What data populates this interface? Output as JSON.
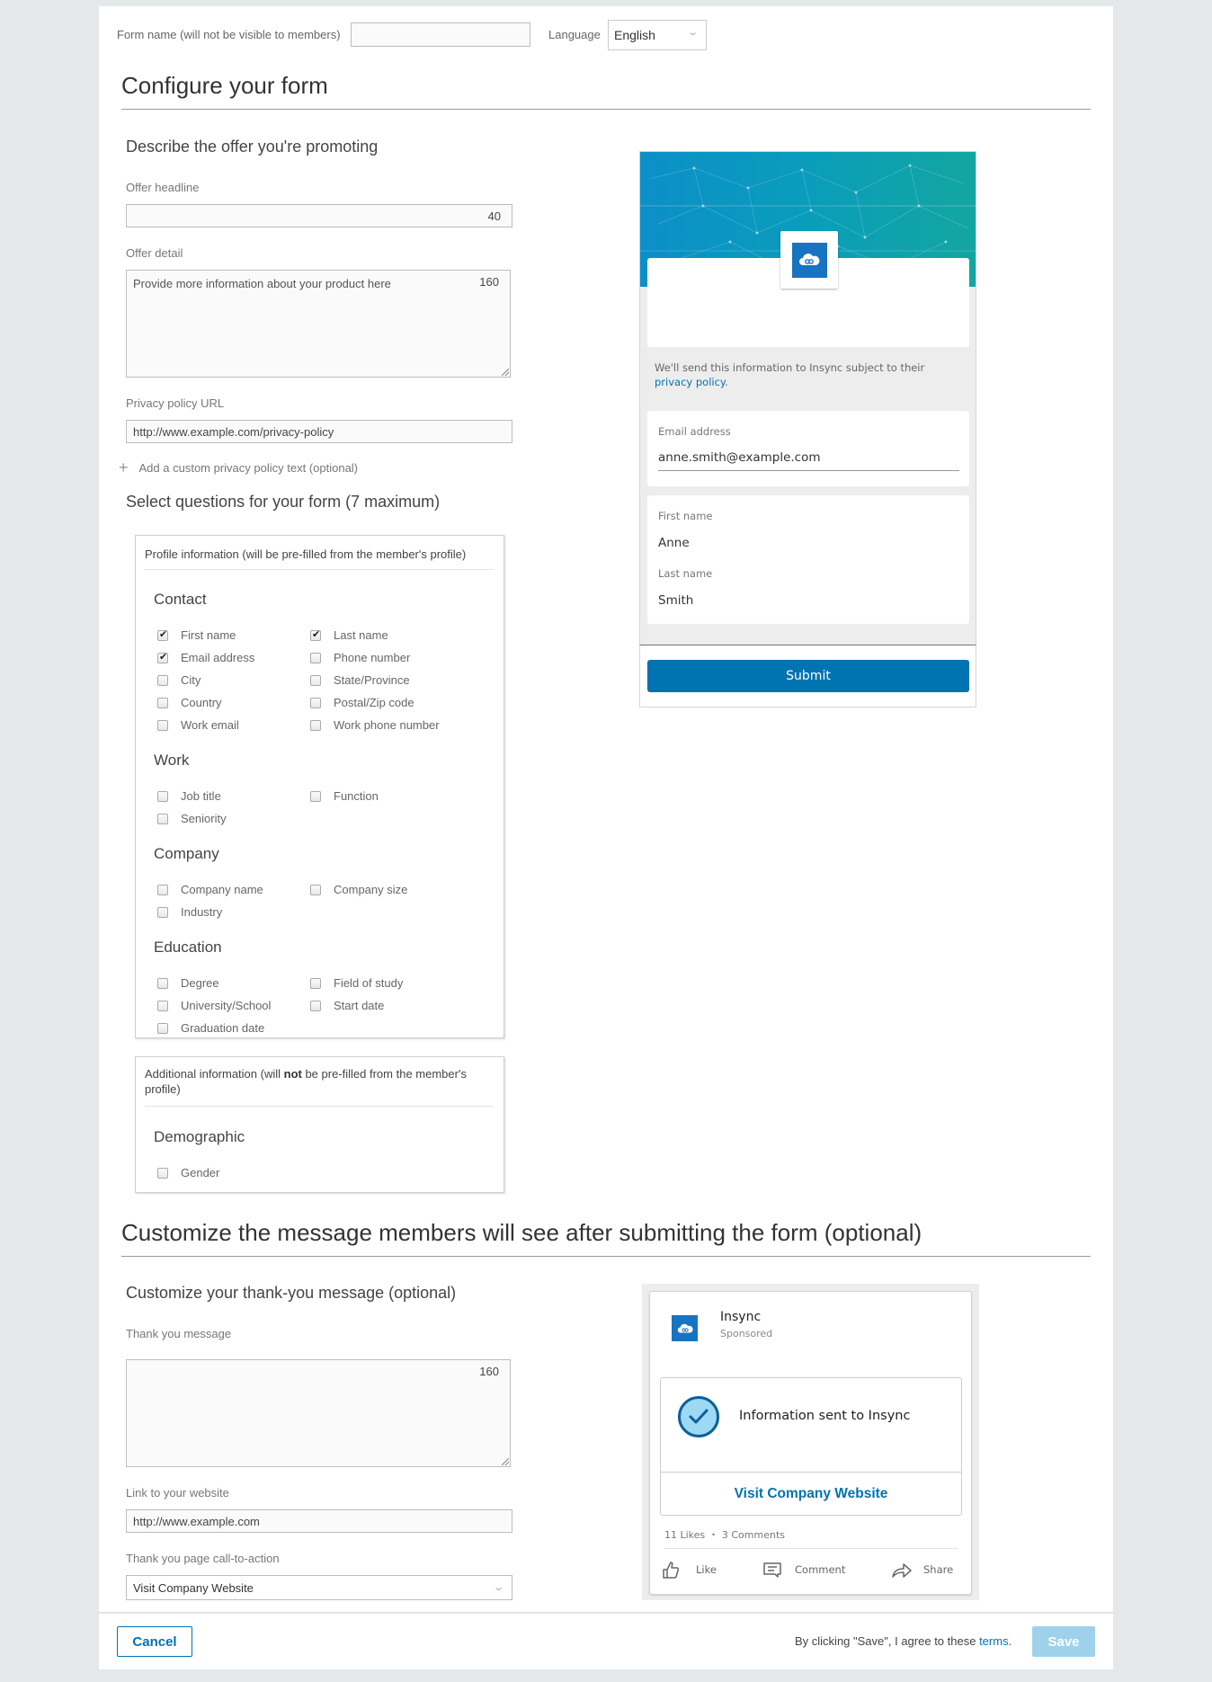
{
  "top_bar": {
    "form_name_label": "Form name (will not be visible to members)",
    "form_name_value": "",
    "language_label": "Language",
    "language_value": "English"
  },
  "configure": {
    "title": "Configure your form",
    "offer_section_title": "Describe the offer you're promoting",
    "offer_headline_label": "Offer headline",
    "offer_headline_value": "",
    "offer_headline_counter": "40",
    "offer_detail_label": "Offer detail",
    "offer_detail_placeholder": "Provide more information about your product here",
    "offer_detail_counter": "160",
    "privacy_url_label": "Privacy policy URL",
    "privacy_url_value": "http://www.example.com/privacy-policy",
    "custom_privacy_link": "Add a custom privacy policy text (optional)",
    "questions_title": "Select questions for your form (7 maximum)"
  },
  "profile_box": {
    "title": "Profile information (will be pre-filled from the member's profile)",
    "categories": [
      {
        "name": "Contact",
        "items": [
          {
            "label": "First name",
            "checked": true
          },
          {
            "label": "Last name",
            "checked": true
          },
          {
            "label": "Email address",
            "checked": true
          },
          {
            "label": "Phone number",
            "checked": false
          },
          {
            "label": "City",
            "checked": false
          },
          {
            "label": "State/Province",
            "checked": false
          },
          {
            "label": "Country",
            "checked": false
          },
          {
            "label": "Postal/Zip code",
            "checked": false
          },
          {
            "label": "Work email",
            "checked": false
          },
          {
            "label": "Work phone number",
            "checked": false
          }
        ]
      },
      {
        "name": "Work",
        "items": [
          {
            "label": "Job title",
            "checked": false
          },
          {
            "label": "Function",
            "checked": false
          },
          {
            "label": "Seniority",
            "checked": false
          }
        ]
      },
      {
        "name": "Company",
        "items": [
          {
            "label": "Company name",
            "checked": false
          },
          {
            "label": "Company size",
            "checked": false
          },
          {
            "label": "Industry",
            "checked": false
          }
        ]
      },
      {
        "name": "Education",
        "items": [
          {
            "label": "Degree",
            "checked": false
          },
          {
            "label": "Field of study",
            "checked": false
          },
          {
            "label": "University/School",
            "checked": false
          },
          {
            "label": "Start date",
            "checked": false
          },
          {
            "label": "Graduation date",
            "checked": false
          }
        ]
      }
    ]
  },
  "additional_box": {
    "title_pre": "Additional information (will ",
    "title_bold": "not",
    "title_post": " be pre-filled from the member's profile)",
    "categories": [
      {
        "name": "Demographic",
        "items": [
          {
            "label": "Gender",
            "checked": false
          }
        ]
      }
    ]
  },
  "form_preview": {
    "privacy_text": "We'll send this information to Insync subject to their ",
    "privacy_link": "privacy policy",
    "privacy_end": ".",
    "email_label": "Email address",
    "email_value": "anne.smith@example.com",
    "first_name_label": "First name",
    "first_name_value": "Anne",
    "last_name_label": "Last name",
    "last_name_value": "Smith",
    "submit_label": "Submit"
  },
  "thank_you": {
    "title": "Customize the message members will see after submitting the form (optional)",
    "subtitle": "Customize your thank-you message (optional)",
    "message_label": "Thank you message",
    "message_value": "",
    "message_counter": "160",
    "website_label": "Link to your website",
    "website_value": "http://www.example.com",
    "cta_label": "Thank you page call-to-action",
    "cta_value": "Visit Company Website"
  },
  "thank_you_preview": {
    "company": "Insync",
    "sponsored": "Sponsored",
    "confirmation": "Information sent to Insync",
    "cta": "Visit Company Website",
    "likes": "11 Likes",
    "comments": "3 Comments",
    "actions": [
      "Like",
      "Comment",
      "Share"
    ]
  },
  "footer": {
    "cancel_label": "Cancel",
    "agree_text": "By clicking \"Save\", I agree to these ",
    "terms_link": "terms",
    "agree_end": ".",
    "save_label": "Save"
  },
  "colors": {
    "accent": "#0073b1",
    "save_disabled": "#9fd2ea",
    "page_bg": "#e5e8eb"
  }
}
